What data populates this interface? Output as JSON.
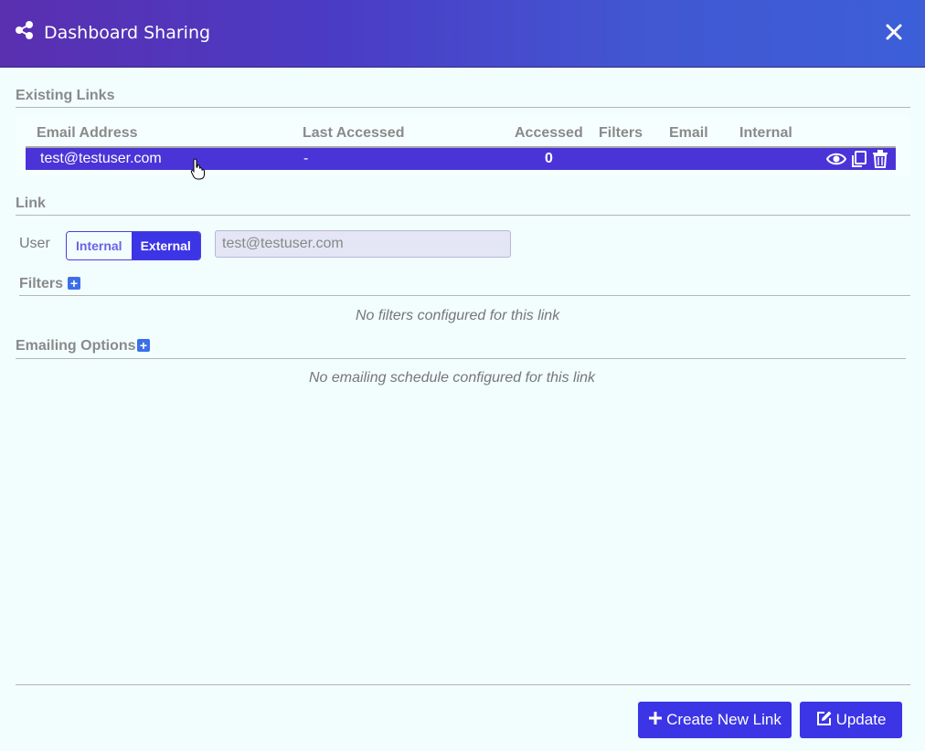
{
  "dialog": {
    "title": "Dashboard Sharing",
    "icon": "share-nodes-icon",
    "close_icon": "close-icon"
  },
  "existing_links": {
    "section_title": "Existing Links",
    "columns": [
      "Email Address",
      "Last Accessed",
      "Accessed",
      "Filters",
      "Email",
      "Internal"
    ],
    "rows": [
      {
        "email": "test@testuser.com",
        "last_accessed": "-",
        "accessed": "0",
        "filters": "",
        "email_flag": "",
        "internal": ""
      }
    ],
    "row_actions": [
      "eye-icon",
      "copy-icon",
      "trash-icon"
    ]
  },
  "link": {
    "section_title": "Link",
    "user_label": "User",
    "toggle": {
      "options": [
        "Internal",
        "External"
      ],
      "selected": "External"
    },
    "user_input": {
      "value": "test@testuser.com"
    }
  },
  "filters": {
    "title": "Filters",
    "empty_message": "No filters configured for this link"
  },
  "emailing": {
    "title": "Emailing Options",
    "empty_message": "No emailing schedule configured for this link"
  },
  "footer": {
    "create_label": "Create New Link",
    "update_label": "Update"
  },
  "colors": {
    "accent": "#3b35e6",
    "row_selected": "#4a34d8",
    "plus": "#3b6fe8",
    "background": "#f2fdfd"
  }
}
